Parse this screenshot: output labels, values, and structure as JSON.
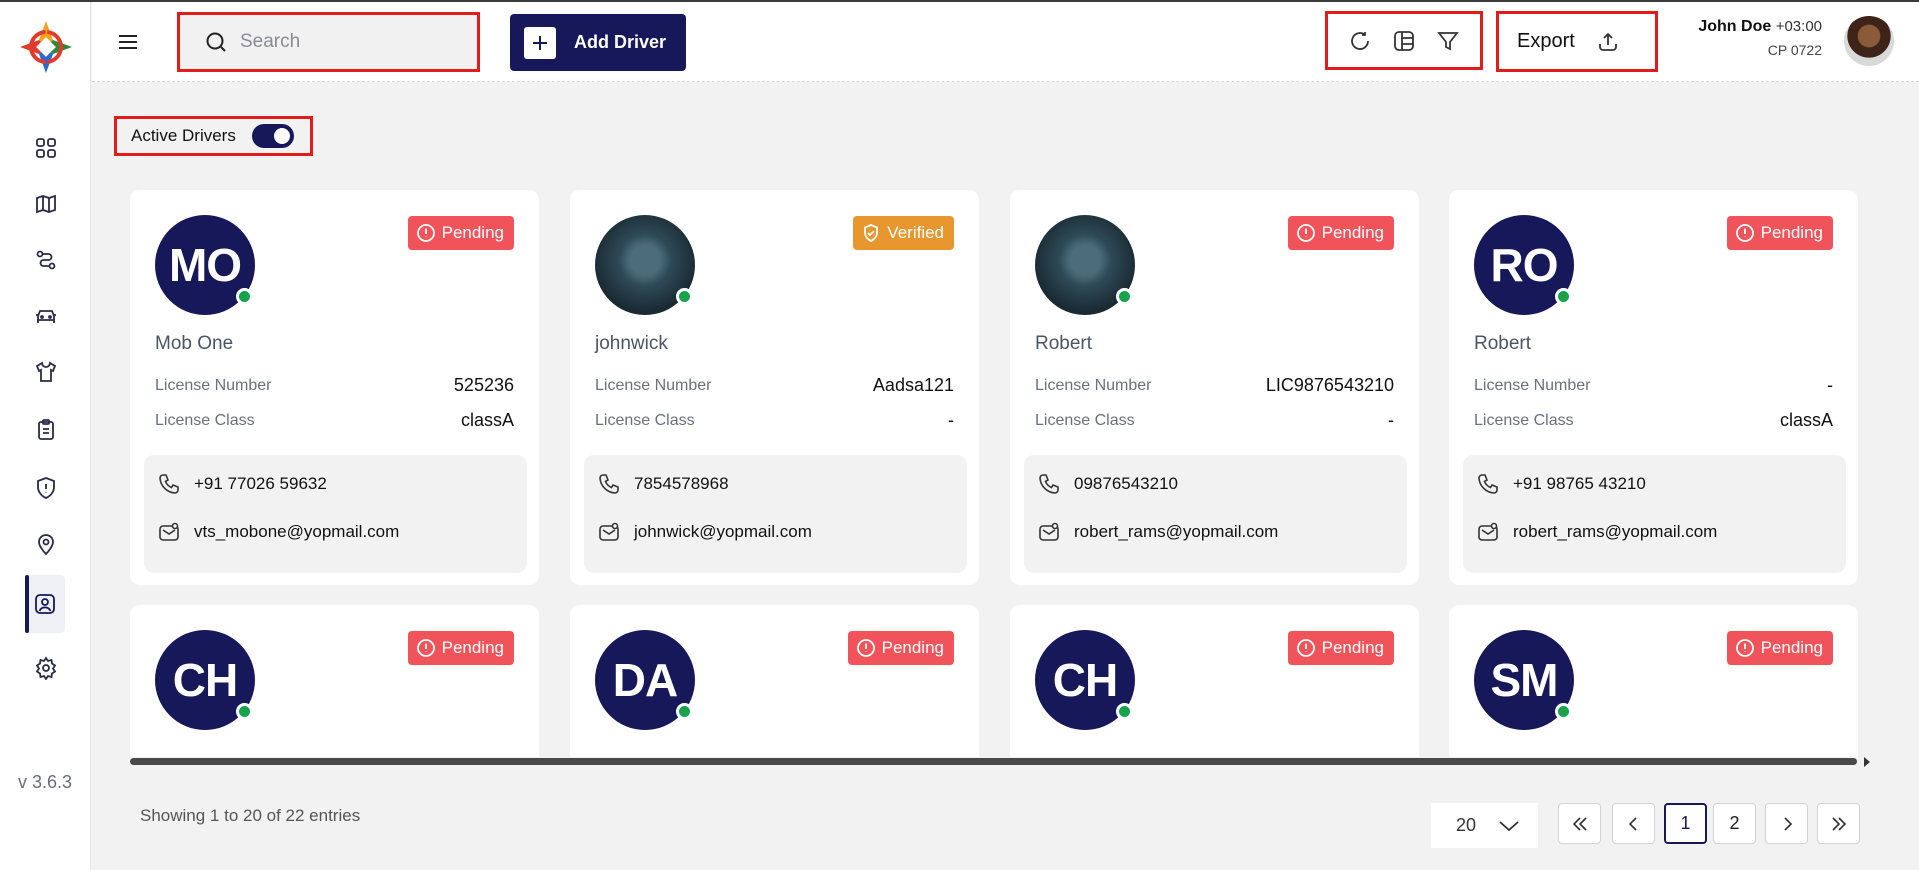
{
  "app": {
    "version": "v 3.6.3"
  },
  "header": {
    "search_placeholder": "Search",
    "add_driver_label": "Add Driver",
    "export_label": "Export",
    "user": {
      "name": "John Doe",
      "timezone": "+03:00",
      "code": "CP 0722"
    }
  },
  "filters": {
    "active_drivers_label": "Active Drivers",
    "active_drivers_on": true
  },
  "labels": {
    "license_number": "License Number",
    "license_class": "License Class"
  },
  "drivers": [
    {
      "initials": "MO",
      "name": "Mob One",
      "status": "Pending",
      "license_number": "525236",
      "license_class": "classA",
      "phone": "+91 77026 59632",
      "email": "vts_mobone@yopmail.com",
      "photo": false
    },
    {
      "initials": "",
      "name": "johnwick",
      "status": "Verified",
      "license_number": "Aadsa121",
      "license_class": "-",
      "phone": "7854578968",
      "email": "johnwick@yopmail.com",
      "photo": true
    },
    {
      "initials": "",
      "name": "Robert",
      "status": "Pending",
      "license_number": "LIC9876543210",
      "license_class": "-",
      "phone": "09876543210",
      "email": "robert_rams@yopmail.com",
      "photo": true
    },
    {
      "initials": "RO",
      "name": "Robert",
      "status": "Pending",
      "license_number": "-",
      "license_class": "classA",
      "phone": "+91 98765 43210",
      "email": "robert_rams@yopmail.com",
      "photo": false
    },
    {
      "initials": "CH",
      "name": "",
      "status": "Pending",
      "photo": false
    },
    {
      "initials": "DA",
      "name": "",
      "status": "Pending",
      "photo": false
    },
    {
      "initials": "CH",
      "name": "",
      "status": "Pending",
      "photo": false
    },
    {
      "initials": "SM",
      "name": "",
      "status": "Pending",
      "photo": false
    }
  ],
  "pagination": {
    "summary": "Showing 1 to 20 of 22 entries",
    "page_size": "20",
    "pages": [
      "1",
      "2"
    ],
    "current_page": "1"
  },
  "colors": {
    "brand": "#16185a",
    "pending": "#f0535a",
    "verified": "#e8962e",
    "online": "#17a34a",
    "highlight": "#e21b1b"
  }
}
